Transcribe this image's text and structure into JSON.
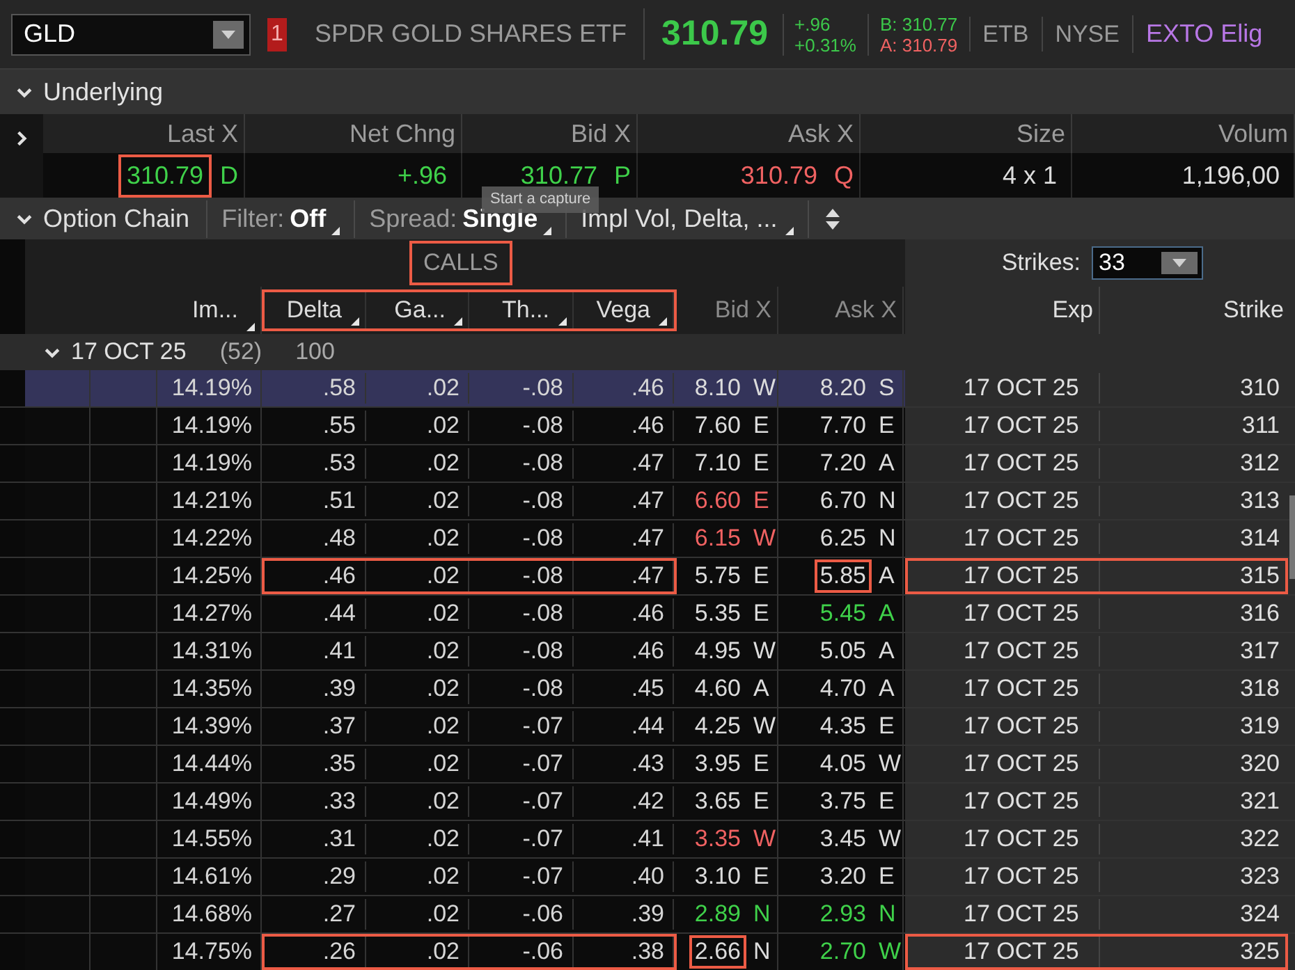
{
  "header": {
    "symbol": "GLD",
    "alert_count": "1",
    "description": "SPDR GOLD SHARES ETF",
    "last": "310.79",
    "change": "+.96",
    "change_pct": "+0.31%",
    "bid": "B: 310.77",
    "ask": "A: 310.79",
    "tags": [
      "ETB",
      "NYSE"
    ],
    "eligibility": "EXTO Elig"
  },
  "underlying": {
    "title": "Underlying",
    "expanded": true,
    "columns": [
      {
        "label": "Last X",
        "value": "310.79",
        "exchange": "D",
        "color": "#3fd14a",
        "boxed": true
      },
      {
        "label": "Net Chng",
        "value": "+.96",
        "color": "#3fd14a",
        "boxed": false
      },
      {
        "label": "Bid X",
        "value": "310.77",
        "exchange": "P",
        "color": "#3fd14a",
        "boxed": false
      },
      {
        "label": "Ask X",
        "value": "310.79",
        "exchange": "Q",
        "color": "#f06262",
        "boxed": false
      },
      {
        "label": "Size",
        "value": "4 x 1",
        "color": "#dcdcdc",
        "boxed": false
      },
      {
        "label": "Volum",
        "value": "1,196,00",
        "color": "#dcdcdc",
        "boxed": false
      }
    ]
  },
  "tooltip": "Start a capture",
  "option_chain": {
    "title": "Option Chain",
    "expanded": true,
    "filter_label": "Filter:",
    "filter_value": "Off",
    "spread_label": "Spread:",
    "spread_value": "Single",
    "layout": "Impl Vol, Delta, ..."
  },
  "calls": {
    "title": "CALLS",
    "boxed": true,
    "strikes_label": "Strikes:",
    "strikes_value": "33",
    "lead_columns": [
      "Im..."
    ],
    "greek_columns": [
      "Delta",
      "Ga...",
      "Th...",
      "Vega"
    ],
    "greeks_boxed": true,
    "quote_columns": [
      "Bid X",
      "Ask X"
    ],
    "exp_column": "Exp",
    "strike_column": "Strike"
  },
  "series": {
    "expiry": "17 OCT 25",
    "count": "(52)",
    "multiplier": "100",
    "expanded": true
  },
  "rows": [
    {
      "iv": "14.19%",
      "delta": ".58",
      "gamma": ".02",
      "theta": "-.08",
      "vega": ".46",
      "bid": {
        "price": "8.10",
        "exchange": "W",
        "color": "#dcdcdc",
        "boxed": false
      },
      "ask": {
        "price": "8.20",
        "exchange": "S",
        "color": "#dcdcdc",
        "boxed": false
      },
      "exp": "17 OCT 25",
      "strike": "310",
      "selected": true,
      "greeks_boxed": false,
      "exp_boxed": false
    },
    {
      "iv": "14.19%",
      "delta": ".55",
      "gamma": ".02",
      "theta": "-.08",
      "vega": ".46",
      "bid": {
        "price": "7.60",
        "exchange": "E",
        "color": "#dcdcdc",
        "boxed": false
      },
      "ask": {
        "price": "7.70",
        "exchange": "E",
        "color": "#dcdcdc",
        "boxed": false
      },
      "exp": "17 OCT 25",
      "strike": "311",
      "selected": false,
      "greeks_boxed": false,
      "exp_boxed": false
    },
    {
      "iv": "14.19%",
      "delta": ".53",
      "gamma": ".02",
      "theta": "-.08",
      "vega": ".47",
      "bid": {
        "price": "7.10",
        "exchange": "E",
        "color": "#dcdcdc",
        "boxed": false
      },
      "ask": {
        "price": "7.20",
        "exchange": "A",
        "color": "#dcdcdc",
        "boxed": false
      },
      "exp": "17 OCT 25",
      "strike": "312",
      "selected": false,
      "greeks_boxed": false,
      "exp_boxed": false
    },
    {
      "iv": "14.21%",
      "delta": ".51",
      "gamma": ".02",
      "theta": "-.08",
      "vega": ".47",
      "bid": {
        "price": "6.60",
        "exchange": "E",
        "color": "#f06262",
        "boxed": false
      },
      "ask": {
        "price": "6.70",
        "exchange": "N",
        "color": "#dcdcdc",
        "boxed": false
      },
      "exp": "17 OCT 25",
      "strike": "313",
      "selected": false,
      "greeks_boxed": false,
      "exp_boxed": false
    },
    {
      "iv": "14.22%",
      "delta": ".48",
      "gamma": ".02",
      "theta": "-.08",
      "vega": ".47",
      "bid": {
        "price": "6.15",
        "exchange": "W",
        "color": "#f06262",
        "boxed": false
      },
      "ask": {
        "price": "6.25",
        "exchange": "N",
        "color": "#dcdcdc",
        "boxed": false
      },
      "exp": "17 OCT 25",
      "strike": "314",
      "selected": false,
      "greeks_boxed": false,
      "exp_boxed": false
    },
    {
      "iv": "14.25%",
      "delta": ".46",
      "gamma": ".02",
      "theta": "-.08",
      "vega": ".47",
      "bid": {
        "price": "5.75",
        "exchange": "E",
        "color": "#dcdcdc",
        "boxed": false
      },
      "ask": {
        "price": "5.85",
        "exchange": "A",
        "color": "#dcdcdc",
        "boxed": true
      },
      "exp": "17 OCT 25",
      "strike": "315",
      "selected": false,
      "greeks_boxed": true,
      "exp_boxed": true
    },
    {
      "iv": "14.27%",
      "delta": ".44",
      "gamma": ".02",
      "theta": "-.08",
      "vega": ".46",
      "bid": {
        "price": "5.35",
        "exchange": "E",
        "color": "#dcdcdc",
        "boxed": false
      },
      "ask": {
        "price": "5.45",
        "exchange": "A",
        "color": "#3fd14a",
        "boxed": false
      },
      "exp": "17 OCT 25",
      "strike": "316",
      "selected": false,
      "greeks_boxed": false,
      "exp_boxed": false
    },
    {
      "iv": "14.31%",
      "delta": ".41",
      "gamma": ".02",
      "theta": "-.08",
      "vega": ".46",
      "bid": {
        "price": "4.95",
        "exchange": "W",
        "color": "#dcdcdc",
        "boxed": false
      },
      "ask": {
        "price": "5.05",
        "exchange": "A",
        "color": "#dcdcdc",
        "boxed": false
      },
      "exp": "17 OCT 25",
      "strike": "317",
      "selected": false,
      "greeks_boxed": false,
      "exp_boxed": false
    },
    {
      "iv": "14.35%",
      "delta": ".39",
      "gamma": ".02",
      "theta": "-.08",
      "vega": ".45",
      "bid": {
        "price": "4.60",
        "exchange": "A",
        "color": "#dcdcdc",
        "boxed": false
      },
      "ask": {
        "price": "4.70",
        "exchange": "A",
        "color": "#dcdcdc",
        "boxed": false
      },
      "exp": "17 OCT 25",
      "strike": "318",
      "selected": false,
      "greeks_boxed": false,
      "exp_boxed": false
    },
    {
      "iv": "14.39%",
      "delta": ".37",
      "gamma": ".02",
      "theta": "-.07",
      "vega": ".44",
      "bid": {
        "price": "4.25",
        "exchange": "W",
        "color": "#dcdcdc",
        "boxed": false
      },
      "ask": {
        "price": "4.35",
        "exchange": "E",
        "color": "#dcdcdc",
        "boxed": false
      },
      "exp": "17 OCT 25",
      "strike": "319",
      "selected": false,
      "greeks_boxed": false,
      "exp_boxed": false
    },
    {
      "iv": "14.44%",
      "delta": ".35",
      "gamma": ".02",
      "theta": "-.07",
      "vega": ".43",
      "bid": {
        "price": "3.95",
        "exchange": "E",
        "color": "#dcdcdc",
        "boxed": false
      },
      "ask": {
        "price": "4.05",
        "exchange": "W",
        "color": "#dcdcdc",
        "boxed": false
      },
      "exp": "17 OCT 25",
      "strike": "320",
      "selected": false,
      "greeks_boxed": false,
      "exp_boxed": false
    },
    {
      "iv": "14.49%",
      "delta": ".33",
      "gamma": ".02",
      "theta": "-.07",
      "vega": ".42",
      "bid": {
        "price": "3.65",
        "exchange": "E",
        "color": "#dcdcdc",
        "boxed": false
      },
      "ask": {
        "price": "3.75",
        "exchange": "E",
        "color": "#dcdcdc",
        "boxed": false
      },
      "exp": "17 OCT 25",
      "strike": "321",
      "selected": false,
      "greeks_boxed": false,
      "exp_boxed": false
    },
    {
      "iv": "14.55%",
      "delta": ".31",
      "gamma": ".02",
      "theta": "-.07",
      "vega": ".41",
      "bid": {
        "price": "3.35",
        "exchange": "W",
        "color": "#f06262",
        "boxed": false
      },
      "ask": {
        "price": "3.45",
        "exchange": "W",
        "color": "#dcdcdc",
        "boxed": false
      },
      "exp": "17 OCT 25",
      "strike": "322",
      "selected": false,
      "greeks_boxed": false,
      "exp_boxed": false
    },
    {
      "iv": "14.61%",
      "delta": ".29",
      "gamma": ".02",
      "theta": "-.07",
      "vega": ".40",
      "bid": {
        "price": "3.10",
        "exchange": "E",
        "color": "#dcdcdc",
        "boxed": false
      },
      "ask": {
        "price": "3.20",
        "exchange": "E",
        "color": "#dcdcdc",
        "boxed": false
      },
      "exp": "17 OCT 25",
      "strike": "323",
      "selected": false,
      "greeks_boxed": false,
      "exp_boxed": false
    },
    {
      "iv": "14.68%",
      "delta": ".27",
      "gamma": ".02",
      "theta": "-.06",
      "vega": ".39",
      "bid": {
        "price": "2.89",
        "exchange": "N",
        "color": "#3fd14a",
        "boxed": false
      },
      "ask": {
        "price": "2.93",
        "exchange": "N",
        "color": "#3fd14a",
        "boxed": false
      },
      "exp": "17 OCT 25",
      "strike": "324",
      "selected": false,
      "greeks_boxed": false,
      "exp_boxed": false
    },
    {
      "iv": "14.75%",
      "delta": ".26",
      "gamma": ".02",
      "theta": "-.06",
      "vega": ".38",
      "bid": {
        "price": "2.66",
        "exchange": "N",
        "color": "#dcdcdc",
        "boxed": true
      },
      "ask": {
        "price": "2.70",
        "exchange": "W",
        "color": "#3fd14a",
        "boxed": false
      },
      "exp": "17 OCT 25",
      "strike": "325",
      "selected": false,
      "greeks_boxed": true,
      "exp_boxed": true
    }
  ]
}
